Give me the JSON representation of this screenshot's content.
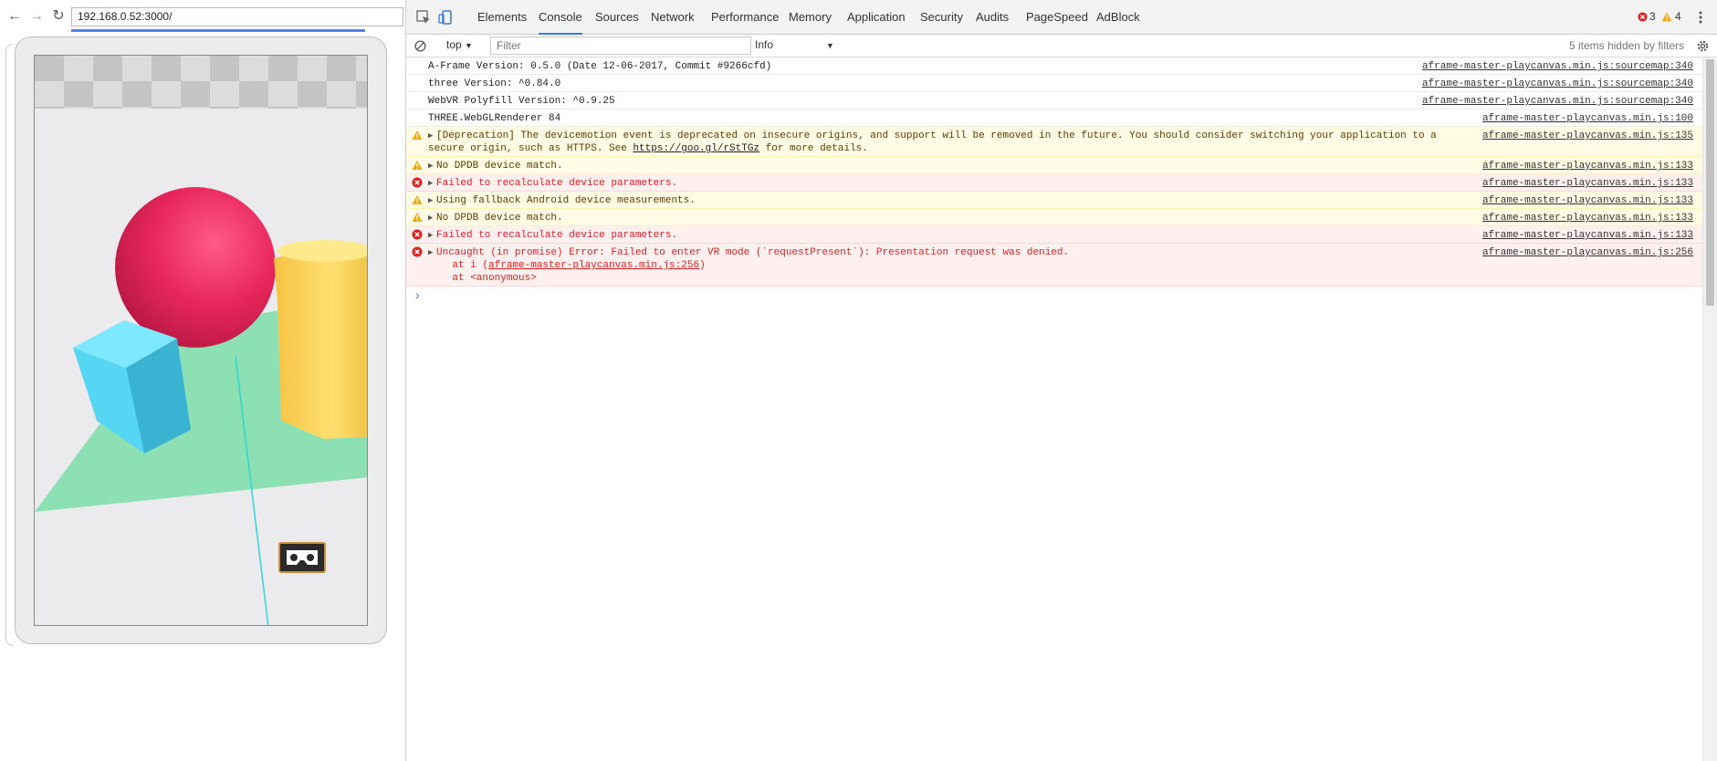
{
  "browser": {
    "url": "192.168.0.52:3000/",
    "back_glyph": "←",
    "forward_glyph": "→",
    "reload_glyph": "↻"
  },
  "scene": {
    "vr_button_label": "VR"
  },
  "devtools": {
    "tabs": [
      "Elements",
      "Console",
      "Sources",
      "Network",
      "Performance",
      "Memory",
      "Application",
      "Security",
      "Audits",
      "PageSpeed",
      "AdBlock"
    ],
    "active_tab": "Console",
    "error_count": "3",
    "warning_count": "4",
    "context": "top",
    "filter_placeholder": "Filter",
    "level": "Info",
    "hidden_note": "5 items hidden by filters",
    "prompt_glyph": "›"
  },
  "console": {
    "messages": [
      {
        "level": "log",
        "text": "A-Frame Version: 0.5.0 (Date 12-06-2017, Commit #9266cfd)",
        "source": "aframe-master-playcanvas.min.js:sourcemap:340"
      },
      {
        "level": "log",
        "text": "three Version: ^0.84.0",
        "source": "aframe-master-playcanvas.min.js:sourcemap:340"
      },
      {
        "level": "log",
        "text": "WebVR Polyfill Version: ^0.9.25",
        "source": "aframe-master-playcanvas.min.js:sourcemap:340"
      },
      {
        "level": "log",
        "text": "THREE.WebGLRenderer 84",
        "source": "aframe-master-playcanvas.min.js:100"
      },
      {
        "level": "warn",
        "line1": "[Deprecation] The devicemotion event is deprecated on insecure origins, and support will be removed in the future. You should consider switching your application to a",
        "line2_pre": "secure origin, such as HTTPS. See ",
        "line2_link": "https://goo.gl/rStTGz",
        "line2_post": " for more details.",
        "source": "aframe-master-playcanvas.min.js:135"
      },
      {
        "level": "warn",
        "text": "No DPDB device match.",
        "source": "aframe-master-playcanvas.min.js:133"
      },
      {
        "level": "error",
        "text": "Failed to recalculate device parameters.",
        "source": "aframe-master-playcanvas.min.js:133"
      },
      {
        "level": "warn",
        "text": "Using fallback Android device measurements.",
        "source": "aframe-master-playcanvas.min.js:133"
      },
      {
        "level": "warn",
        "text": "No DPDB device match.",
        "source": "aframe-master-playcanvas.min.js:133"
      },
      {
        "level": "error",
        "text": "Failed to recalculate device parameters.",
        "source": "aframe-master-playcanvas.min.js:133"
      },
      {
        "level": "error",
        "line1": "Uncaught (in promise) Error: Failed to enter VR mode (`requestPresent`): Presentation request was denied.",
        "line2_pre": "    at i (",
        "line2_link": "aframe-master-playcanvas.min.js:256",
        "line2_post": ")",
        "line3": "    at <anonymous>",
        "source": "aframe-master-playcanvas.min.js:256"
      }
    ]
  },
  "colors": {
    "sphere": "#e8275c",
    "cube": "#47c8e8",
    "cylinder": "#f9cf4f",
    "plane": "#8ce0b4",
    "error": "#e02020",
    "warning": "#f1a80c",
    "accent": "#3879d9"
  }
}
